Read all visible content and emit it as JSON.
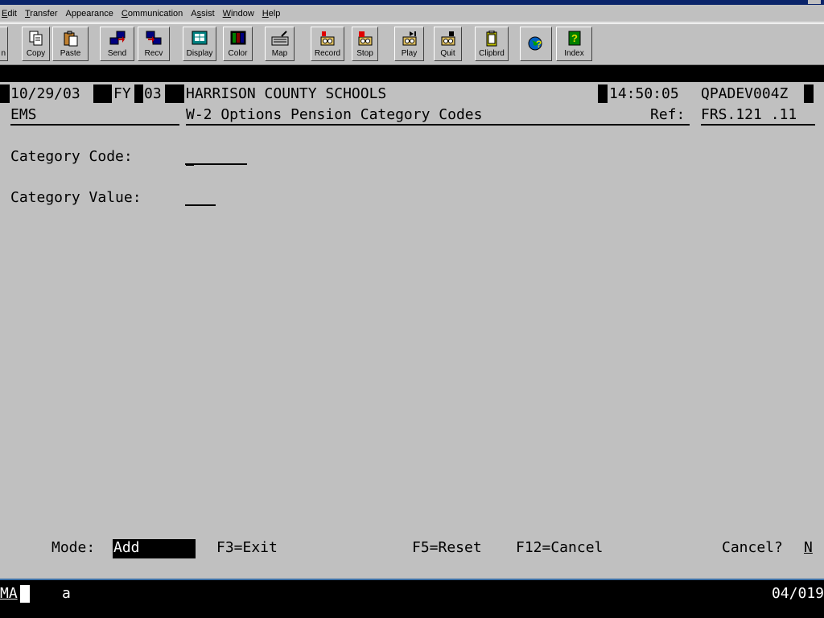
{
  "menu": [
    {
      "label": "Edit",
      "u": "E"
    },
    {
      "label": "Transfer",
      "u": "T"
    },
    {
      "label": "Appearance",
      "u": ""
    },
    {
      "label": "Communication",
      "u": "C"
    },
    {
      "label": "Assist",
      "u": "s"
    },
    {
      "label": "Window",
      "u": "W"
    },
    {
      "label": "Help",
      "u": "H"
    }
  ],
  "toolbar": {
    "first_partial_label": "n",
    "copy": "Copy",
    "paste": "Paste",
    "send": "Send",
    "recv": "Recv",
    "display": "Display",
    "color": "Color",
    "map": "Map",
    "record": "Record",
    "stop": "Stop",
    "play": "Play",
    "quit": "Quit",
    "clipbrd": "Clipbrd",
    "index": "Index"
  },
  "header": {
    "date": "10/29/03",
    "fy_label": "FY",
    "fy_value": "03",
    "org": "HARRISON COUNTY SCHOOLS",
    "time": "14:50:05",
    "screen_id": "QPADEV004Z",
    "system": "EMS",
    "screen_title": "W-2 Options Pension Category Codes",
    "ref_label": "Ref:",
    "ref_value": "FRS.121 .11"
  },
  "form": {
    "category_code_label": "Category Code:",
    "category_code_value": "",
    "category_value_label": "Category Value:",
    "category_value_value": ""
  },
  "footer": {
    "mode_label": "Mode:",
    "mode_value": "Add",
    "f3": "F3=Exit",
    "f5": "F5=Reset",
    "f12": "F12=Cancel",
    "cancel_label": "Cancel?",
    "cancel_value": "N"
  },
  "status": {
    "left": "MA",
    "indicator": "a",
    "position": "04/019"
  }
}
